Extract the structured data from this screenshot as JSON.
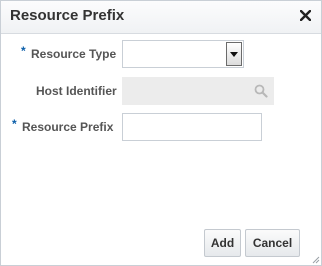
{
  "dialog": {
    "title": "Resource Prefix",
    "close_icon": "close-icon"
  },
  "form": {
    "resource_type": {
      "required_marker": "*",
      "label": "Resource Type",
      "value": "",
      "dropdown_icon": "chevron-down-icon"
    },
    "host_identifier": {
      "label": "Host Identifier",
      "value": "",
      "search_icon": "search-icon",
      "disabled": true
    },
    "resource_prefix": {
      "required_marker": "*",
      "label": "Resource Prefix",
      "value": "",
      "placeholder": ""
    }
  },
  "footer": {
    "add_label": "Add",
    "cancel_label": "Cancel"
  },
  "colors": {
    "required": "#0b5ea9",
    "disabled_field": "#ececec",
    "label_text": "#555555"
  }
}
